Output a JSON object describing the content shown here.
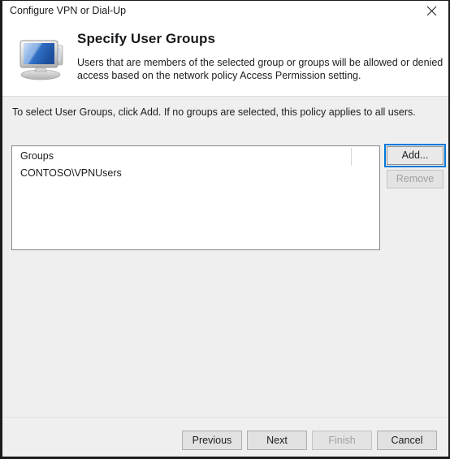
{
  "window": {
    "title": "Configure VPN or Dial-Up",
    "close_icon": "close-icon"
  },
  "header": {
    "icon": "computer-monitor-icon",
    "title": "Specify User Groups",
    "description": "Users that are members of the selected group or groups will be allowed or denied access based on the network policy Access Permission setting."
  },
  "body": {
    "instruction": "To select User Groups, click Add. If no groups are selected, this policy applies to all users.",
    "list": {
      "column_header": "Groups",
      "rows": [
        "CONTOSO\\VPNUsers"
      ]
    },
    "side_buttons": {
      "add_label": "Add...",
      "remove_label": "Remove"
    }
  },
  "footer": {
    "previous_label": "Previous",
    "next_label": "Next",
    "finish_label": "Finish",
    "cancel_label": "Cancel"
  },
  "colors": {
    "focus_ring": "#0078d7",
    "window_bg": "#efefef",
    "panel_bg": "#ffffff",
    "disabled_text": "#a0a0a0"
  }
}
